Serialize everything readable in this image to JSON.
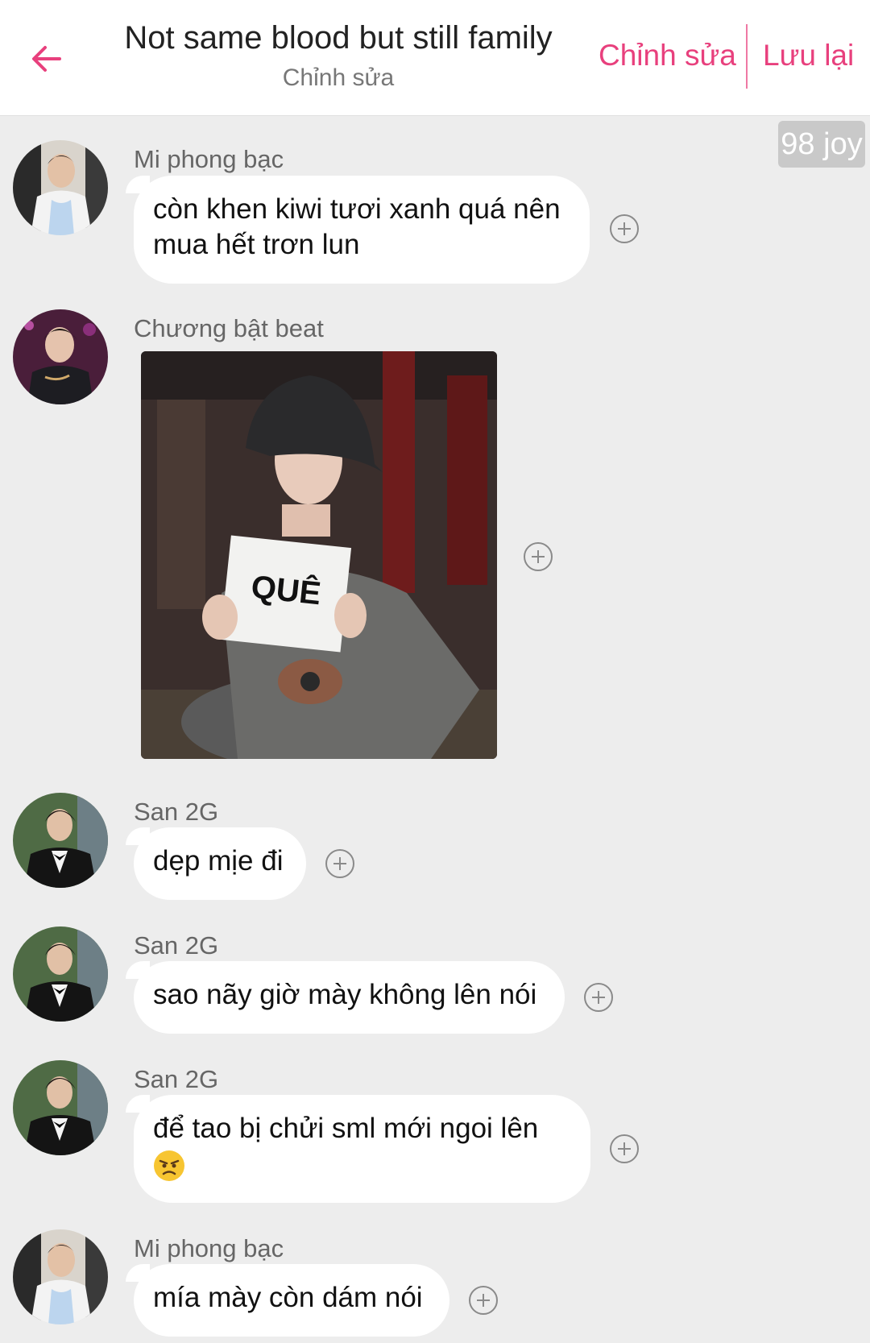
{
  "header": {
    "title": "Not same blood but still family",
    "subtitle": "Chỉnh sửa",
    "edit_label": "Chỉnh sửa",
    "save_label": "Lưu lại"
  },
  "joy_badge": "98 joy",
  "accent_color": "#e8407d",
  "messages": [
    {
      "sender": "Mi phong bạc",
      "text": "còn khen kiwi tươi xanh quá nên mua hết trơn lun"
    },
    {
      "sender": "Chương bật beat",
      "sticker_text": "QUÊ"
    },
    {
      "sender": "San 2G",
      "text": "dẹp mịe đi"
    },
    {
      "sender": "San 2G",
      "text": "sao nãy giờ mày không lên nói"
    },
    {
      "sender": "San 2G",
      "text": "để tao bị chửi sml mới ngoi lên",
      "emoji": "angry-face-emoji"
    },
    {
      "sender": "Mi phong bạc",
      "text": "mía mày còn dám nói"
    }
  ]
}
